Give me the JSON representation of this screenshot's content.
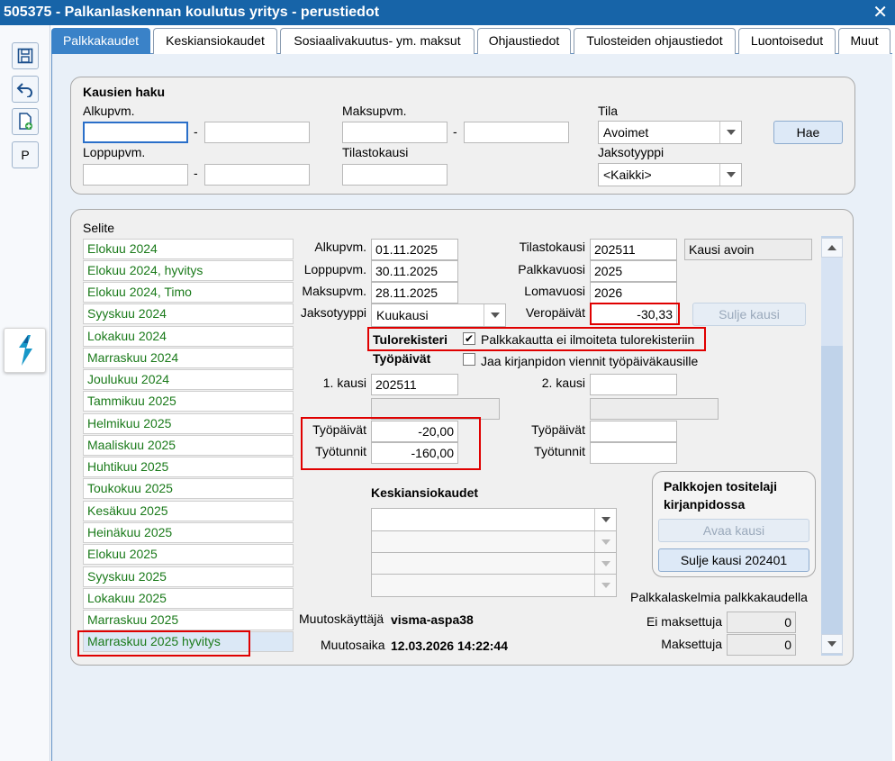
{
  "window": {
    "title": "505375 - Palkanlaskennan koulutus yritys - perustiedot"
  },
  "toolbar": {
    "p_label": "P"
  },
  "tabs": [
    "Palkkakaudet",
    "Keskiansiokaudet",
    "Sosiaalivakuutus- ym. maksut",
    "Ohjaustiedot",
    "Tulosteiden ohjaustiedot",
    "Luontoisedut",
    "Muut"
  ],
  "search": {
    "title": "Kausien haku",
    "alkupvm_label": "Alkupvm.",
    "loppupvm_label": "Loppupvm.",
    "maksupvm_label": "Maksupvm.",
    "tilastokausi_label": "Tilastokausi",
    "tila_label": "Tila",
    "tila_value": "Avoimet",
    "jaksotyyppi_label": "Jaksotyyppi",
    "jaksotyyppi_value": "<Kaikki>",
    "dash": "-",
    "hae_button": "Hae"
  },
  "selite": {
    "label": "Selite",
    "items": [
      "Elokuu 2024",
      "Elokuu 2024, hyvitys",
      "Elokuu 2024, Timo",
      "Syyskuu 2024",
      "Lokakuu 2024",
      "Marraskuu 2024",
      "Joulukuu 2024",
      "Tammikuu 2025",
      "Helmikuu 2025",
      "Maaliskuu 2025",
      "Huhtikuu 2025",
      "Toukokuu 2025",
      "Kesäkuu 2025",
      "Heinäkuu 2025",
      "Elokuu 2025",
      "Syyskuu 2025",
      "Lokakuu 2025",
      "Marraskuu 2025",
      "Marraskuu 2025 hyvitys"
    ]
  },
  "detail": {
    "alkupvm_label": "Alkupvm.",
    "alkupvm": "01.11.2025",
    "loppupvm_label": "Loppupvm.",
    "loppupvm": "30.11.2025",
    "maksupvm_label": "Maksupvm.",
    "maksupvm": "28.11.2025",
    "jaksotyyppi_label": "Jaksotyyppi",
    "jaksotyyppi": "Kuukausi",
    "tilastokausi_label": "Tilastokausi",
    "tilastokausi": "202511",
    "kausi_status": "Kausi avoin",
    "palkkavuosi_label": "Palkkavuosi",
    "palkkavuosi": "2025",
    "lomavuosi_label": "Lomavuosi",
    "lomavuosi": "2026",
    "veropaivat_label": "Veropäivät",
    "veropaivat": "-30,33",
    "sulje_kausi_button": "Sulje kausi",
    "tulorekisteri_label": "Tulorekisteri",
    "tulorekisteri_checkbox": "Palkkakautta ei ilmoiteta tulorekisteriin",
    "tulorekisteri_checked": "✔",
    "tyopaivat_heading": "Työpäivät",
    "jaa_checkbox": "Jaa kirjanpidon viennit työpäiväkausille",
    "kausi1_label": "1. kausi",
    "kausi1": "202511",
    "kausi2_label": "2. kausi",
    "kausi2": "",
    "tyopaivat_label": "Työpäivät",
    "tyopaivat": "-20,00",
    "tyotunnit_label": "Työtunnit",
    "tyotunnit": "-160,00",
    "tyopaivat2_label": "Työpäivät",
    "tyotunnit2_label": "Työtunnit",
    "keskiansiokaudet_heading": "Keskiansiokaudet",
    "tositelaji_title": "Palkkojen tositelaji kirjanpidossa",
    "avaa_kausi_button": "Avaa kausi",
    "sulje_kausi_2_button": "Sulje kausi 202401",
    "palkkalaskelmia_title": "Palkkalaskelmia palkkakaudella",
    "ei_maksettuja_label": "Ei maksettuja",
    "ei_maksettuja": "0",
    "maksettuja_label": "Maksettuja",
    "maksettuja": "0",
    "muutoskayttaja_label": "Muutoskäyttäjä",
    "muutoskayttaja": "visma-aspa38",
    "muutosaika_label": "Muutosaika",
    "muutosaika": "12.03.2026 14:22:44"
  },
  "colors": {
    "titlebar": "#1764a8",
    "tab_active": "#3a82c8",
    "list_text": "#1a7a1a",
    "highlight_border": "#e00000"
  }
}
